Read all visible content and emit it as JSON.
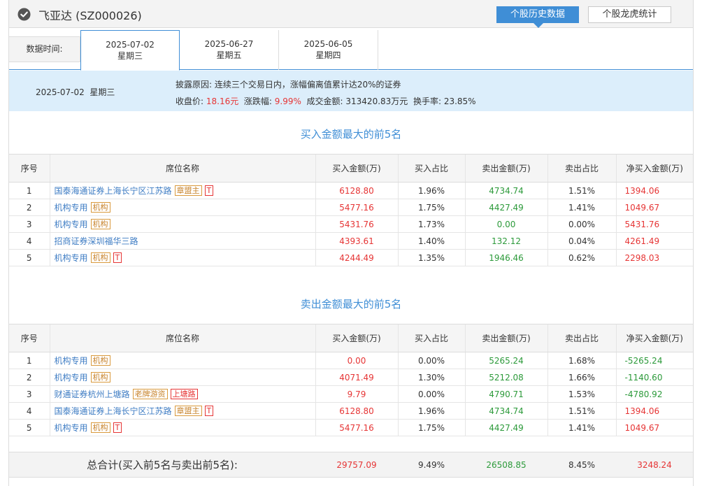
{
  "header": {
    "title": "飞亚达 (SZ000026)",
    "history_button": "个股历史数据",
    "tiger_button": "个股龙虎统计"
  },
  "tabs": {
    "label": "数据时间:",
    "items": [
      {
        "date": "2025-07-02",
        "weekday": "星期三"
      },
      {
        "date": "2025-06-27",
        "weekday": "星期五"
      },
      {
        "date": "2025-06-05",
        "weekday": "星期四"
      }
    ]
  },
  "info": {
    "date": "2025-07-02",
    "weekday": "星期三",
    "reason_label": "披露原因:",
    "reason": "连续三个交易日内，涨幅偏离值累计达20%的证券",
    "close_label": "收盘价:",
    "close": "18.16元",
    "change_label": "涨跌幅:",
    "change": "9.99%",
    "turnover_label": "成交金额:",
    "turnover": "313420.83万元",
    "rate_label": "换手率:",
    "rate": "23.85%"
  },
  "columns": [
    "序号",
    "席位名称",
    "买入金额(万)",
    "买入占比",
    "卖出金额(万)",
    "卖出占比",
    "净买入金额(万)"
  ],
  "buy_section": {
    "title": "买入金额最大的前5名",
    "rows": [
      {
        "no": "1",
        "name": "国泰海通证券上海长宁区江苏路",
        "tags": [
          {
            "text": "章盟主",
            "style": "y"
          },
          {
            "text": "T",
            "style": "r"
          }
        ],
        "buy": "6128.80",
        "buy_pct": "1.96%",
        "sell": "4734.74",
        "sell_pct": "1.51%",
        "net": "1394.06"
      },
      {
        "no": "2",
        "name": "机构专用",
        "tags": [
          {
            "text": "机构",
            "style": "y"
          }
        ],
        "buy": "5477.16",
        "buy_pct": "1.75%",
        "sell": "4427.49",
        "sell_pct": "1.41%",
        "net": "1049.67"
      },
      {
        "no": "3",
        "name": "机构专用",
        "tags": [
          {
            "text": "机构",
            "style": "y"
          }
        ],
        "buy": "5431.76",
        "buy_pct": "1.73%",
        "sell": "0.00",
        "sell_pct": "0.00%",
        "net": "5431.76"
      },
      {
        "no": "4",
        "name": "招商证券深圳福华三路",
        "tags": [],
        "buy": "4393.61",
        "buy_pct": "1.40%",
        "sell": "132.12",
        "sell_pct": "0.04%",
        "net": "4261.49"
      },
      {
        "no": "5",
        "name": "机构专用",
        "tags": [
          {
            "text": "机构",
            "style": "y"
          },
          {
            "text": "T",
            "style": "r"
          }
        ],
        "buy": "4244.49",
        "buy_pct": "1.35%",
        "sell": "1946.46",
        "sell_pct": "0.62%",
        "net": "2298.03"
      }
    ]
  },
  "sell_section": {
    "title": "卖出金额最大的前5名",
    "rows": [
      {
        "no": "1",
        "name": "机构专用",
        "tags": [
          {
            "text": "机构",
            "style": "y"
          }
        ],
        "buy": "0.00",
        "buy_pct": "0.00%",
        "sell": "5265.24",
        "sell_pct": "1.68%",
        "net": "-5265.24"
      },
      {
        "no": "2",
        "name": "机构专用",
        "tags": [
          {
            "text": "机构",
            "style": "y"
          }
        ],
        "buy": "4071.49",
        "buy_pct": "1.30%",
        "sell": "5212.08",
        "sell_pct": "1.66%",
        "net": "-1140.60"
      },
      {
        "no": "3",
        "name": "财通证券杭州上塘路",
        "tags": [
          {
            "text": "老牌游资",
            "style": "y"
          },
          {
            "text": "上塘路",
            "style": "r"
          }
        ],
        "buy": "9.79",
        "buy_pct": "0.00%",
        "sell": "4790.71",
        "sell_pct": "1.53%",
        "net": "-4780.92"
      },
      {
        "no": "4",
        "name": "国泰海通证券上海长宁区江苏路",
        "tags": [
          {
            "text": "章盟主",
            "style": "y"
          },
          {
            "text": "T",
            "style": "r"
          }
        ],
        "buy": "6128.80",
        "buy_pct": "1.96%",
        "sell": "4734.74",
        "sell_pct": "1.51%",
        "net": "1394.06"
      },
      {
        "no": "5",
        "name": "机构专用",
        "tags": [
          {
            "text": "机构",
            "style": "y"
          },
          {
            "text": "T",
            "style": "r"
          }
        ],
        "buy": "5477.16",
        "buy_pct": "1.75%",
        "sell": "4427.49",
        "sell_pct": "1.41%",
        "net": "1049.67"
      }
    ]
  },
  "total": {
    "label": "总合计(买入前5名与卖出前5名):",
    "buy": "29757.09",
    "buy_pct": "9.49%",
    "sell": "26508.85",
    "sell_pct": "8.45%",
    "net": "3248.24"
  },
  "colors": {
    "accent": "#3f8ed6",
    "up": "#e63535",
    "down": "#2c9a3a",
    "tag_yellow": "#c7822a",
    "info_bg": "#dceefb"
  }
}
